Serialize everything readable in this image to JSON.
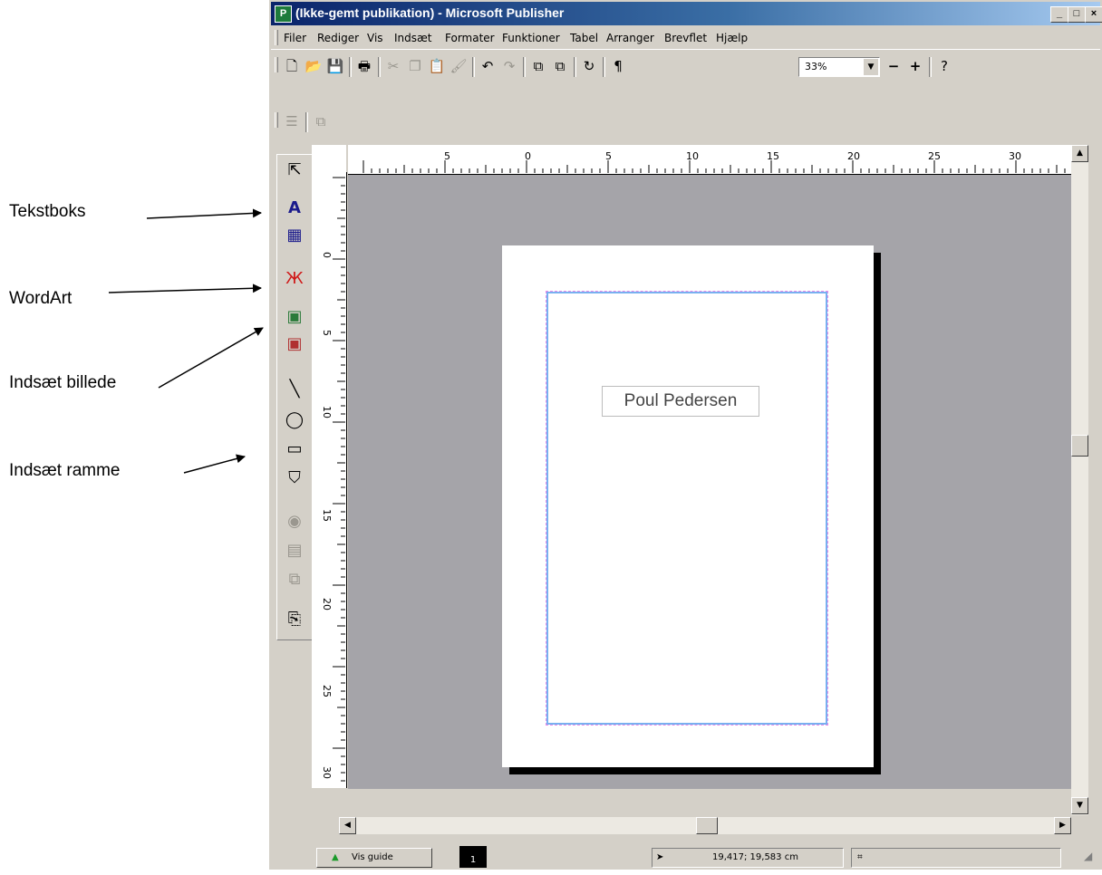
{
  "annotations": [
    {
      "label": "Tekstboks"
    },
    {
      "label": "WordArt"
    },
    {
      "label": "Indsæt billede"
    },
    {
      "label": "Indsæt ramme"
    }
  ],
  "window": {
    "title": "(Ikke-gemt publikation) - Microsoft Publisher",
    "controls": [
      "_",
      "□",
      "×"
    ]
  },
  "menu": [
    "Filer",
    "Rediger",
    "Vis",
    "Indsæt",
    "Formater",
    "Funktioner",
    "Tabel",
    "Arranger",
    "Brevflet",
    "Hjælp"
  ],
  "toolbar": {
    "zoom": "33%"
  },
  "rulers": {
    "horizontal_labels": [
      "5",
      "0",
      "5",
      "10",
      "15",
      "20",
      "25",
      "30"
    ],
    "vertical_labels": [
      "0",
      "5",
      "10",
      "15",
      "20",
      "25",
      "30"
    ]
  },
  "document": {
    "textbox_text": "Poul Pedersen"
  },
  "statusbar": {
    "guide_button": "Vis guide",
    "page_number": "1",
    "position": "19,417; 19,583 cm"
  }
}
